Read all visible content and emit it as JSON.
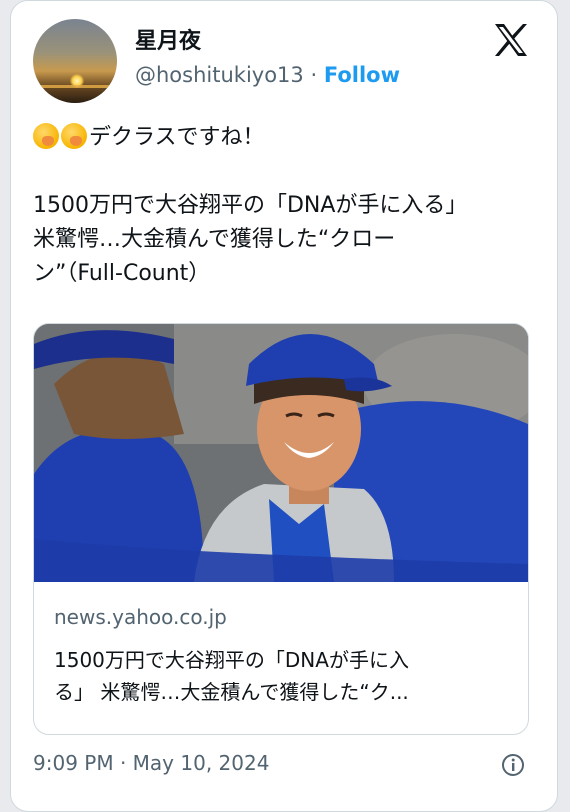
{
  "author": {
    "display_name": "星月夜",
    "handle": "@hoshitukiyo13",
    "separator": "·",
    "follow_label": "Follow"
  },
  "icons": {
    "brand_logo": "x-logo-icon",
    "info": "info-icon",
    "emoji": "face-with-hand-over-mouth-emoji"
  },
  "tweet": {
    "line1_text": "デクラスですね！",
    "body_lines": [
      "1500万円で大谷翔平の「DNAが手に入る」",
      "米驚愕…大金積んで獲得した“クロー",
      "ン”（Full-Count）"
    ]
  },
  "link_card": {
    "domain": "news.yahoo.co.jp",
    "title_lines": [
      "1500万円で大谷翔平の「DNAが手に入",
      "る」 米驚愕…大金積んで獲得した“ク..."
    ]
  },
  "footer": {
    "timestamp": "9:09 PM · May 10, 2024"
  },
  "colors": {
    "accent": "#1d9bf0",
    "text": "#0f1419",
    "muted": "#536471",
    "border": "#cfd9de",
    "jersey_blue": "#1f3fb0"
  }
}
